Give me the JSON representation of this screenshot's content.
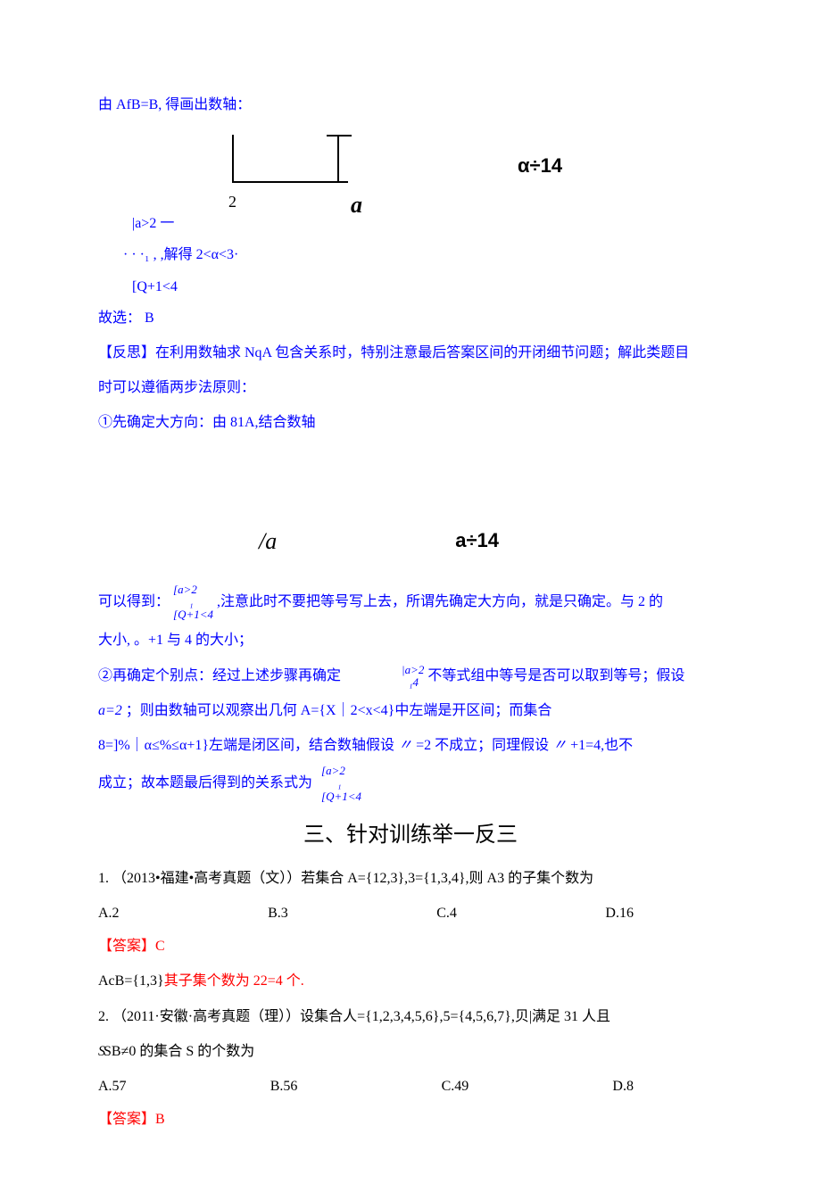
{
  "l1_a": "由 ",
  "l1_b": "AfB=B,",
  "l1_c": "得画出数轴：",
  "diagram1": {
    "left": "2",
    "right": "a",
    "side": "α÷14"
  },
  "l2_brace_top": "|a>2 一",
  "l2_a": "· · ·₁",
  "l2_b": ", ,解得 2<α<3·",
  "l2_brace_bot": "[Q+1<4",
  "l3_a": "故选：",
  "l3_b": "B",
  "l4": "【反思】在利用数轴求 NqA 包含关系时，特别注意最后答案区间的开闭细节问题；解此类题目",
  "l5": "时可以遵循两步法原则：",
  "l6": "①先确定大方向：由 81A,结合数轴",
  "diagram2": {
    "left": "/a",
    "side": "a÷14"
  },
  "l7_a": "可以得到：",
  "l7_brace_top": "[a>2",
  "l7_brace_mid": "₁",
  "l7_brace_bot": "[Q+1<4",
  "l7_b": ",注意此时不要把等号写上去，所谓先确定大方向，就是只确定。与 2 的",
  "l8": "大小, 。+1 与 4 的大小；",
  "l9_a": "②再确定个别点：经过上述步骤再确定",
  "l9_brace_top": "|a>2",
  "l9_brace_bot": "₁4",
  "l9_b": "不等式组中等号是否可以取到等号；假设",
  "l10_a": "a=2",
  "l10_b": "；则由数轴可以观察出几何 A={X｜2<x<4}中左端是开区间；而集合",
  "l11_a": "8=]%｜α≤%≤α+1}左端是闭区间，结合数轴假设",
  "l11_b": "〃",
  "l11_c": "=2 不成立；同理假设",
  "l11_d": "〃",
  "l11_e": "+1=4,也不",
  "l12_a": "成立；故本题最后得到的关系式为",
  "l12_brace_top": "[a>2",
  "l12_brace_mid": "₁",
  "l12_brace_bot": "[Q+1<4",
  "sec3": "三、针对训练举一反三",
  "q1_a": "1.   （2013•福建•高考真题（文））若集合 A={12,3},3={1,3,4},则 A3 的子集个数为",
  "q1_opts": {
    "a": "A.2",
    "b": "B.3",
    "c": "C.4",
    "d": "D.16"
  },
  "ans1_a": "【答案】",
  "ans1_b": "C",
  "expl1_a": "AcB={1,3}",
  "expl1_b": "其子集个数为 22=4 个.",
  "q2_a": "2.   （2011·安徽·高考真题（理））设集合人={1,2,3,4,5,6},5={4,5,6,7},贝|满足 31 人且",
  "q2_b": "SB≠0 的集合 S 的个数为",
  "q2_opts": {
    "a": "A.57",
    "b": "B.56",
    "c": "C.49",
    "d": "D.8"
  },
  "ans2_a": "【答案】",
  "ans2_b": "B"
}
